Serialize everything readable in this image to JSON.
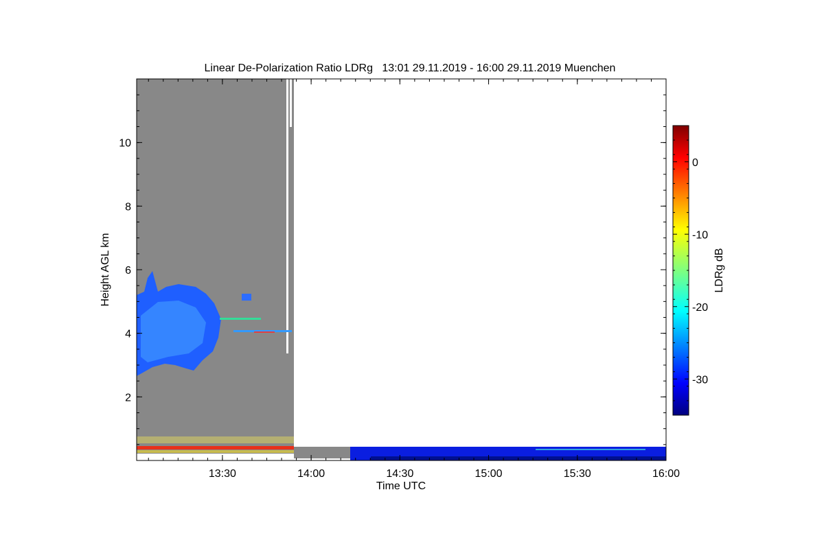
{
  "chart_data": {
    "type": "heatmap",
    "title": "Linear De-Polarization Ratio LDRg   13:01 29.11.2019 - 16:00 29.11.2019 Muenchen",
    "xlabel": "Time UTC",
    "ylabel": "Height AGL km",
    "xlim": [
      "13:01",
      "16:00"
    ],
    "ylim": [
      0,
      12
    ],
    "x_ticks": [
      "13:30",
      "14:00",
      "14:30",
      "15:00",
      "15:30",
      "16:00"
    ],
    "y_ticks": [
      "2",
      "4",
      "6",
      "8",
      "10"
    ],
    "colorbar": {
      "label": "LDRg dB",
      "range": [
        -35,
        5
      ],
      "ticks": [
        "0",
        "-10",
        "-20",
        "-30"
      ],
      "colormap": "jet"
    },
    "no_data_color": "#888888",
    "regions": [
      {
        "name": "gray no-signal",
        "time": [
          "13:01",
          "13:54"
        ],
        "height_km": [
          0.2,
          12
        ]
      },
      {
        "name": "ice cloud",
        "time": [
          "13:01",
          "13:31"
        ],
        "height_km": [
          2.7,
          5.5
        ],
        "ldr_db": -28
      },
      {
        "name": "melting layer",
        "time": [
          "13:01",
          "13:54"
        ],
        "height_km": [
          0.3,
          0.45
        ],
        "ldr_db": -2
      },
      {
        "name": "low-level",
        "time": [
          "14:15",
          "16:00"
        ],
        "height_km": [
          0.0,
          0.4
        ],
        "ldr_db": -32
      }
    ]
  }
}
